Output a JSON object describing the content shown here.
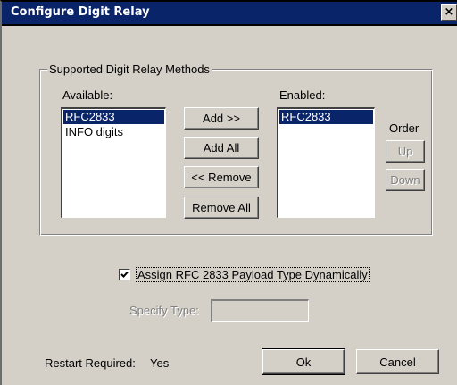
{
  "window": {
    "title": "Configure Digit Relay",
    "close_glyph": "×"
  },
  "group": {
    "legend": "Supported Digit Relay Methods",
    "available_label": "Available:",
    "enabled_label": "Enabled:",
    "order_label": "Order",
    "available_items": [
      "RFC2833",
      "INFO digits"
    ],
    "available_selected_index": 0,
    "enabled_items": [
      "RFC2833"
    ],
    "enabled_selected_index": 0,
    "buttons": {
      "add": "Add >>",
      "add_all": "Add  All",
      "remove": "<< Remove",
      "remove_all": "Remove All",
      "up": "Up",
      "down": "Down"
    }
  },
  "payload": {
    "checkbox_label": "Assign RFC 2833 Payload Type Dynamically",
    "checked": true,
    "specify_type_label": "Specify Type:",
    "specify_type_value": ""
  },
  "footer": {
    "restart_label": "Restart Required:",
    "restart_value": "Yes",
    "ok": "Ok",
    "cancel": "Cancel"
  },
  "colors": {
    "title_bar": "#0a246a",
    "dialog_face": "#d4d0c8",
    "selection": "#0a246a"
  }
}
